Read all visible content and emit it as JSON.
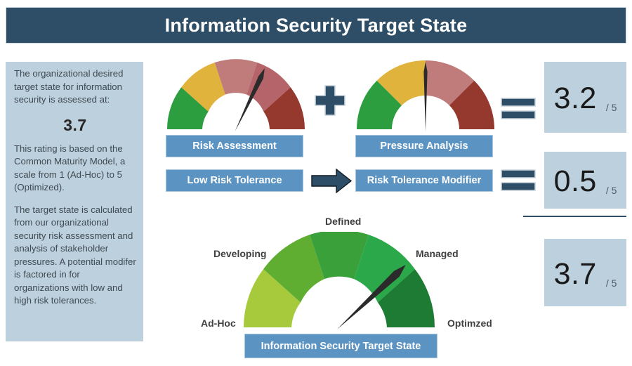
{
  "header": {
    "title": "Information Security Target State"
  },
  "side_panel": {
    "paragraph_1": "The organizational desired target state for information security is assessed at:",
    "score": "3.7",
    "paragraph_2": "This rating is based on the Common Maturity Model, a scale from 1 (Ad-Hoc) to 5 (Optimized).",
    "paragraph_3": "The target state is calculated from our organizational security risk assessment and analysis of stakeholder pressures. A potential modifer is factored in for organizations with low and high risk tolerances."
  },
  "captions": {
    "risk_assessment": "Risk Assessment",
    "low_risk_tolerance": "Low Risk Tolerance",
    "pressure_analysis": "Pressure Analysis",
    "risk_tolerance_modifier": "Risk Tolerance Modifier",
    "target_state": "Information Security Target State"
  },
  "results": {
    "risk_assessment_value": "3.2",
    "risk_assessment_denominator": "/ 5",
    "modifier_value": "0.5",
    "modifier_denominator": "/ 5",
    "target_value": "3.7",
    "target_denominator": "/ 5"
  },
  "maturity_labels": {
    "ad_hoc": "Ad-Hoc",
    "developing": "Developing",
    "defined": "Defined",
    "managed": "Managed",
    "optimized": "Optimzed"
  },
  "colors": {
    "header_navy": "#2d4e66",
    "panel_blue": "#bdd0dd",
    "caption_blue": "#5b93c2",
    "needle_black": "#2b2b2b",
    "risk_segment_1": "#2c9e3f",
    "risk_segment_2": "#e0b33c",
    "risk_segment_3": "#c07b7b",
    "risk_segment_4": "#b5656a",
    "risk_segment_5": "#95382e",
    "maturity_segment_1": "#a6ca3c",
    "maturity_segment_2": "#5fae32",
    "maturity_segment_3": "#3aa03a",
    "maturity_segment_4": "#2aa84a",
    "maturity_segment_5": "#1e7b33"
  },
  "chart_data": [
    {
      "type": "gauge",
      "name": "risk-assessment-gauge",
      "title": "Risk Assessment",
      "value": 3.2,
      "range": [
        0,
        5
      ],
      "segment_count": 5,
      "segments": [
        {
          "from": 0,
          "to": 1,
          "color": "#2c9e3f"
        },
        {
          "from": 1,
          "to": 2,
          "color": "#e0b33c"
        },
        {
          "from": 2,
          "to": 3,
          "color": "#c07b7b"
        },
        {
          "from": 3,
          "to": 4,
          "color": "#b5656a"
        },
        {
          "from": 4,
          "to": 5,
          "color": "#95382e"
        }
      ],
      "needle_value": 3.2,
      "readout": "3.2 / 5"
    },
    {
      "type": "gauge",
      "name": "pressure-analysis-gauge",
      "title": "Pressure Analysis",
      "value": 2.5,
      "range": [
        0,
        5
      ],
      "segment_count": 4,
      "segments": [
        {
          "from": 0,
          "to": 1.25,
          "color": "#2c9e3f"
        },
        {
          "from": 1.25,
          "to": 2.5,
          "color": "#e0b33c"
        },
        {
          "from": 2.5,
          "to": 3.75,
          "color": "#c07b7b"
        },
        {
          "from": 3.75,
          "to": 5,
          "color": "#95382e"
        }
      ],
      "needle_value": 2.5,
      "readout": "0.5 / 5"
    },
    {
      "type": "gauge",
      "name": "information-security-target-state-gauge",
      "title": "Information Security Target State",
      "value": 3.7,
      "range": [
        0,
        5
      ],
      "segment_count": 5,
      "segments": [
        {
          "from": 0,
          "to": 1,
          "color": "#a6ca3c",
          "label": "Ad-Hoc"
        },
        {
          "from": 1,
          "to": 2,
          "color": "#5fae32",
          "label": "Developing"
        },
        {
          "from": 2,
          "to": 3,
          "color": "#3aa03a",
          "label": "Defined"
        },
        {
          "from": 3,
          "to": 4,
          "color": "#2aa84a",
          "label": "Managed"
        },
        {
          "from": 4,
          "to": 5,
          "color": "#1e7b33",
          "label": "Optimzed"
        }
      ],
      "needle_value": 3.7,
      "readout": "3.7 / 5"
    }
  ]
}
